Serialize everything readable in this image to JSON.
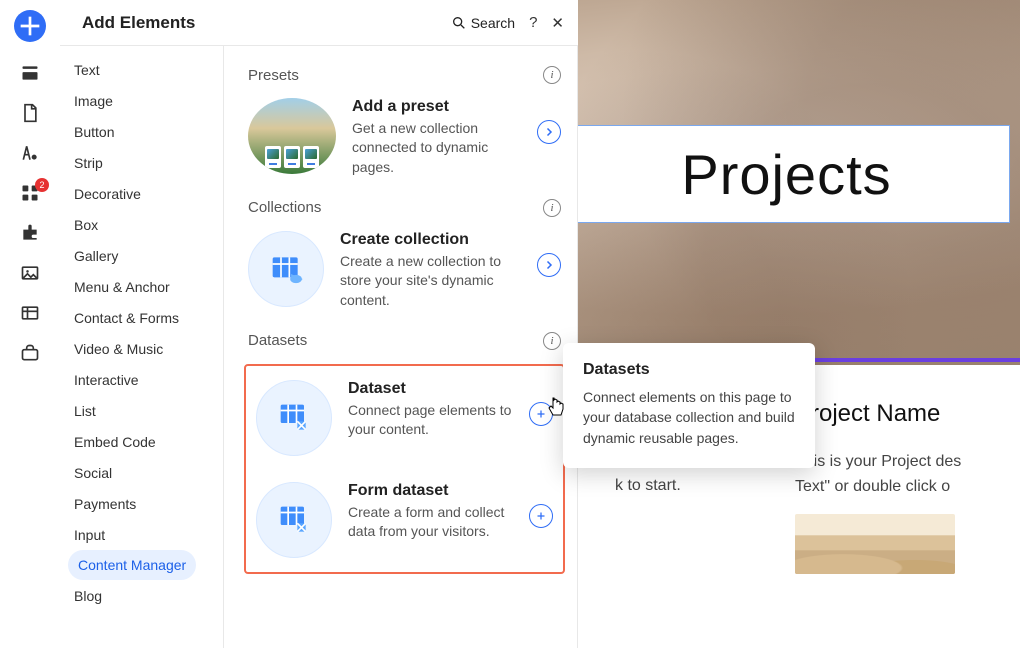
{
  "panel": {
    "title": "Add Elements",
    "search_label": "Search"
  },
  "rail": {
    "badge": "2"
  },
  "categories": [
    "Text",
    "Image",
    "Button",
    "Strip",
    "Decorative",
    "Box",
    "Gallery",
    "Menu & Anchor",
    "Contact & Forms",
    "Video & Music",
    "Interactive",
    "List",
    "Embed Code",
    "Social",
    "Payments",
    "Input",
    "Content Manager",
    "Blog"
  ],
  "active_category_index": 16,
  "sections": {
    "presets": {
      "title": "Presets",
      "card": {
        "title": "Add a preset",
        "desc": "Get a new collection connected to dynamic pages."
      }
    },
    "collections": {
      "title": "Collections",
      "card": {
        "title": "Create collection",
        "desc": "Create a new collection to store your site's dynamic content."
      }
    },
    "datasets": {
      "title": "Datasets",
      "cards": [
        {
          "title": "Dataset",
          "desc": "Connect page elements to your content."
        },
        {
          "title": "Form dataset",
          "desc": "Create a form and collect data from your visitors."
        }
      ]
    }
  },
  "tooltip": {
    "title": "Datasets",
    "desc": "Connect elements on this page to your database collection and build dynamic reusable pages."
  },
  "canvas": {
    "hero_title": "Projects",
    "left_col_text": "ide a brief\n the context\non \"Edit\nk to start.",
    "right_col": {
      "name": "Project Name",
      "desc": "This is your Project des\nText\" or double click o"
    }
  }
}
